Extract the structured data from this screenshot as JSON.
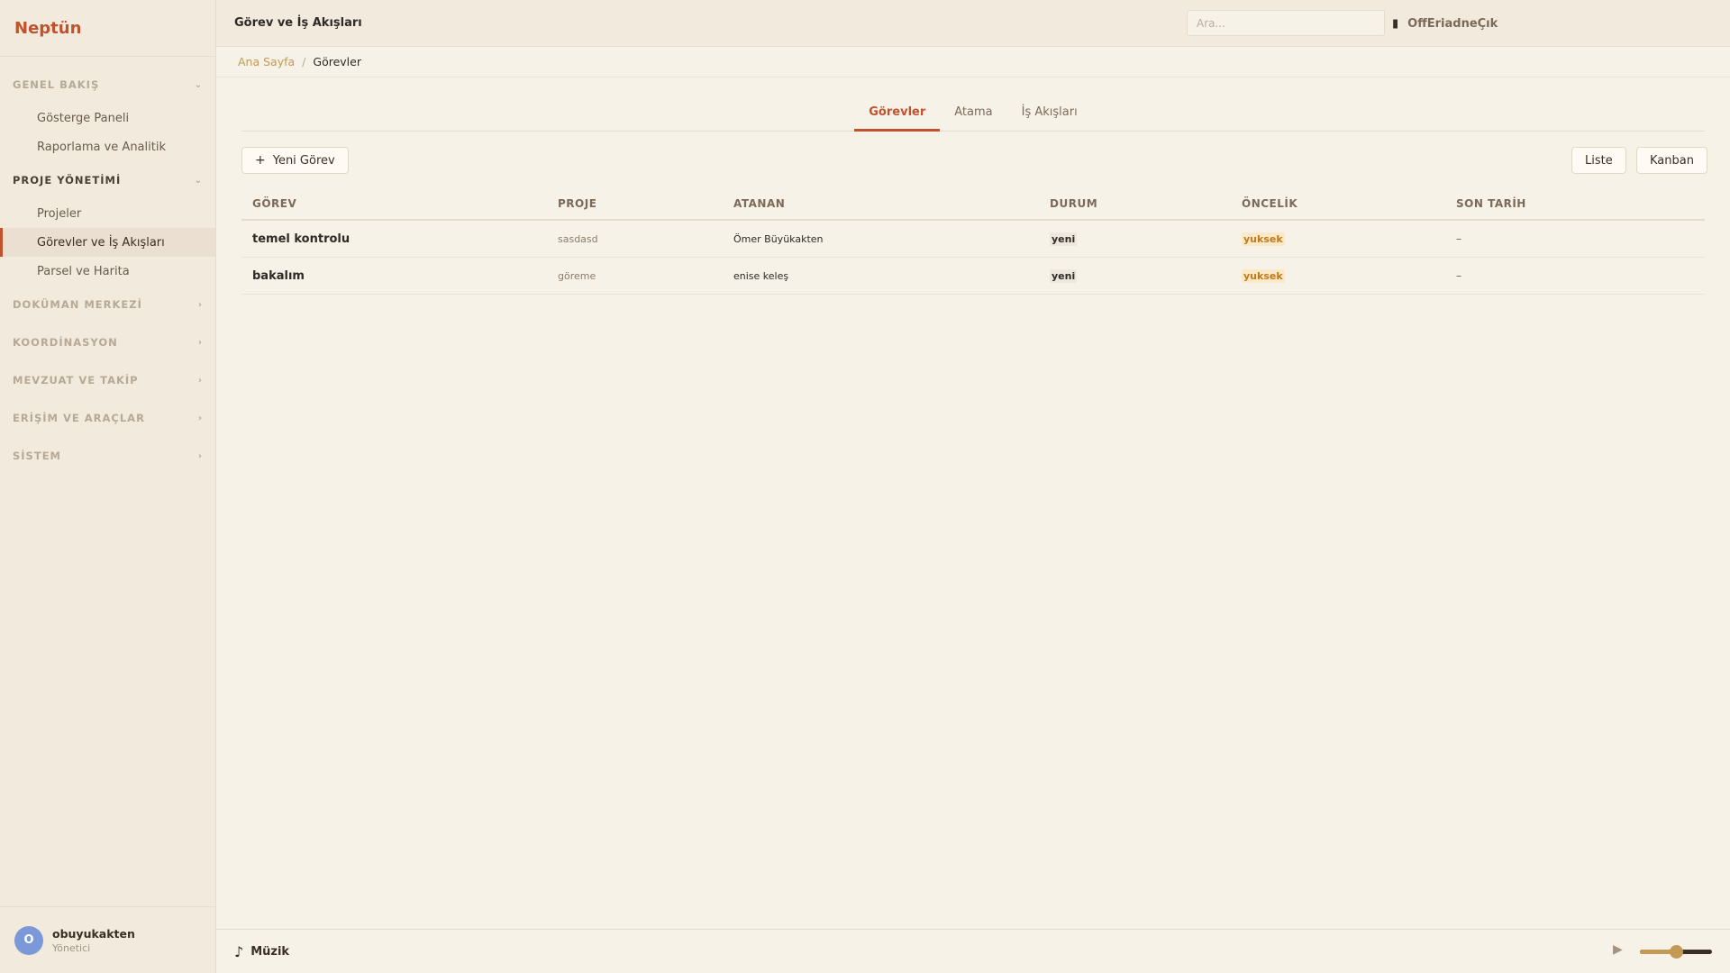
{
  "brand": "Neptün",
  "header": {
    "title": "Görev ve İş Akışları",
    "search_placeholder": "Ara...",
    "actions": [
      "OffEriadneÇık"
    ],
    "bookmark_icon": "bookmark-icon"
  },
  "breadcrumb": {
    "home": "Ana Sayfa",
    "separator": "/",
    "current": "Görevler"
  },
  "sidebar": {
    "sections": [
      {
        "title": "GENEL BAKIŞ",
        "open": true,
        "items": [
          "Gösterge Paneli",
          "Raporlama ve Analitik"
        ]
      },
      {
        "title": "PROJE YÖNETİMİ",
        "open": true,
        "items": [
          "Projeler",
          "Görevler ve İş Akışları",
          "Parsel ve Harita"
        ],
        "active": "Görevler ve İş Akışları"
      },
      {
        "title": "DOKÜMAN MERKEZİ",
        "open": false,
        "items": []
      },
      {
        "title": "KOORDİNASYON",
        "open": false,
        "items": []
      },
      {
        "title": "MEVZUAT VE TAKİP",
        "open": false,
        "items": []
      },
      {
        "title": "ERİŞİM VE ARAÇLAR",
        "open": false,
        "items": []
      },
      {
        "title": "SİSTEM",
        "open": false,
        "items": []
      }
    ],
    "user": {
      "initial": "O",
      "name": "obuyukakten",
      "role": "Yönetici"
    }
  },
  "tabs": [
    "Görevler",
    "Atama",
    "İş Akışları"
  ],
  "active_tab": "Görevler",
  "toolbar": {
    "new_task": "Yeni Görev",
    "list_view": "Liste",
    "kanban_view": "Kanban"
  },
  "table": {
    "columns": [
      "GÖREV",
      "PROJE",
      "ATANAN",
      "DURUM",
      "ÖNCELİK",
      "SON TARİH"
    ],
    "rows": [
      {
        "task": "temel kontrolu",
        "project": "sasdasd",
        "assignee": "Ömer Büyükakten",
        "status": "yeni",
        "priority": "yuksek",
        "due": "–"
      },
      {
        "task": "bakalım",
        "project": "göreme",
        "assignee": "enise keleş",
        "status": "yeni",
        "priority": "yuksek",
        "due": "–"
      }
    ]
  },
  "player": {
    "label": "Müzik",
    "volume": 0.5
  },
  "colors": {
    "accent": "#c0532e",
    "gold": "#c39a55",
    "background": "#f7f2e8",
    "sidebar": "#f1eadd"
  }
}
